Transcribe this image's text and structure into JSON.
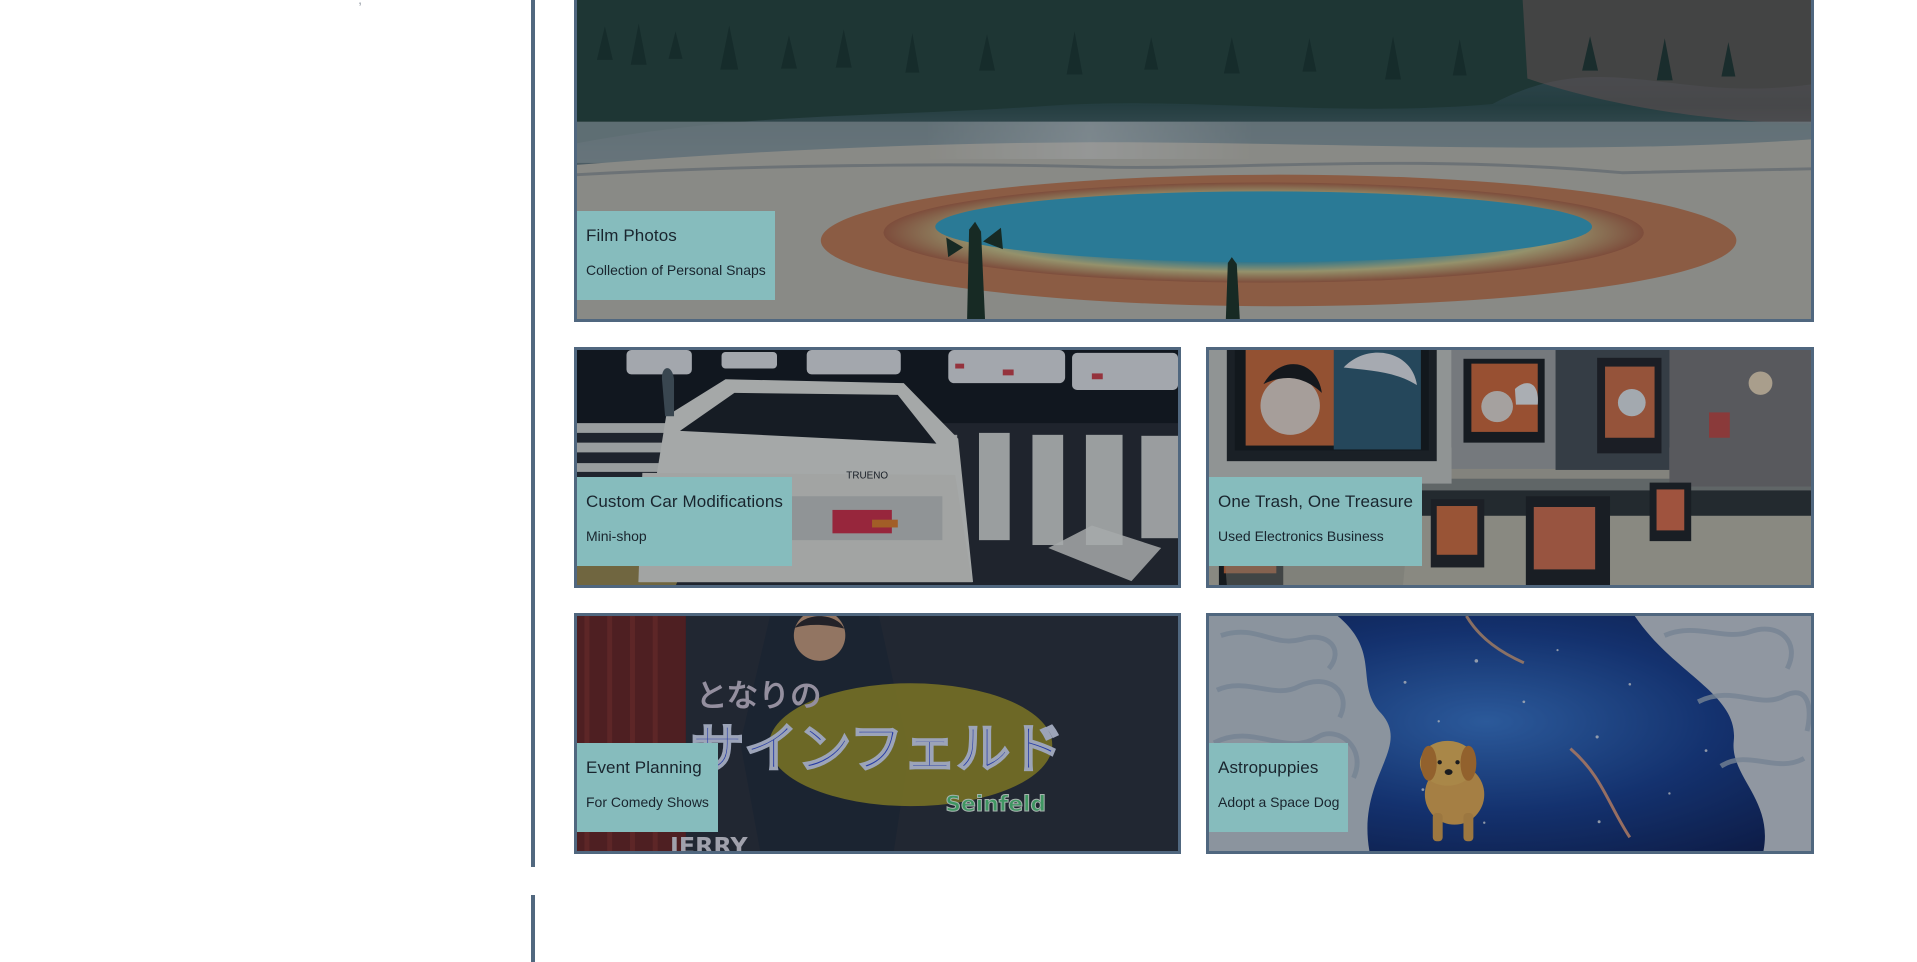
{
  "sidebar": {
    "stub_text": ","
  },
  "cards": [
    {
      "title": "Film Photos",
      "subtitle": "Collection of Personal Snaps",
      "image": "hot-spring-landscape"
    },
    {
      "title": "Custom Car Modifications",
      "subtitle": "Mini-shop",
      "image": "street-car-scene"
    },
    {
      "title": "One Trash, One Treasure",
      "subtitle": "Used Electronics Business",
      "image": "used-television-display"
    },
    {
      "title": "Event Planning",
      "subtitle": "For Comedy Shows",
      "image": "comedy-show-title-card"
    },
    {
      "title": "Astropuppies",
      "subtitle": "Adopt a Space Dog",
      "image": "space-dog-painting"
    }
  ],
  "image_text": {
    "car_plate": "TRUENO",
    "show_small_title": "となりの",
    "show_main_title": "サインフェルド",
    "show_brand": "Seinfeld",
    "show_lower_text": "JERRY"
  },
  "colors": {
    "border": "#50677f",
    "caption_background": "#86bcbd",
    "caption_text": "#19252e",
    "rule": "#51687f"
  }
}
